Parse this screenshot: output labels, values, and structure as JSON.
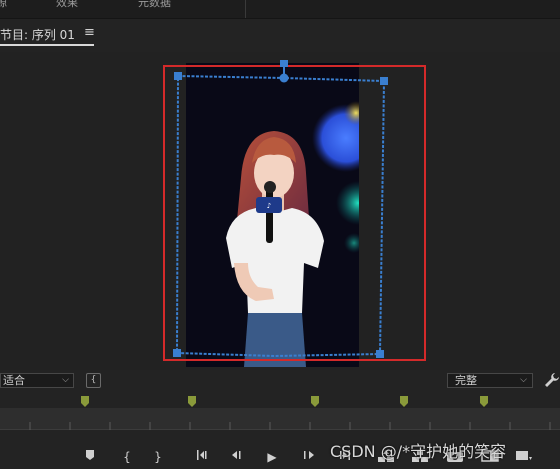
{
  "top_tabs": [
    "源",
    "效果",
    "元数据"
  ],
  "panel": {
    "title": "节目: 序列 01",
    "menu_icon": "hamburger-menu-icon"
  },
  "controls": {
    "fit_value": "适合",
    "quality_value": "完整",
    "safe_margins_icon": "safe-margins-icon",
    "settings_icon": "wrench-icon"
  },
  "timeline_markers": {
    "color": "#8a9a3a",
    "count": 5
  },
  "transport_icons": [
    "add-marker-icon",
    "mark-in-icon",
    "mark-out-icon",
    "go-to-in-icon",
    "step-back-icon",
    "play-icon",
    "step-forward-icon",
    "go-to-out-icon",
    "lift-icon",
    "extract-icon",
    "export-frame-icon",
    "comparison-view-icon",
    "more-icon"
  ],
  "play_glyph": "▶",
  "watermark": "CSDN @/*守护她的笑容",
  "colors": {
    "selection_border": "#d42a2a",
    "transform_handles": "#3a7fd0",
    "panel_bg": "#232323"
  }
}
